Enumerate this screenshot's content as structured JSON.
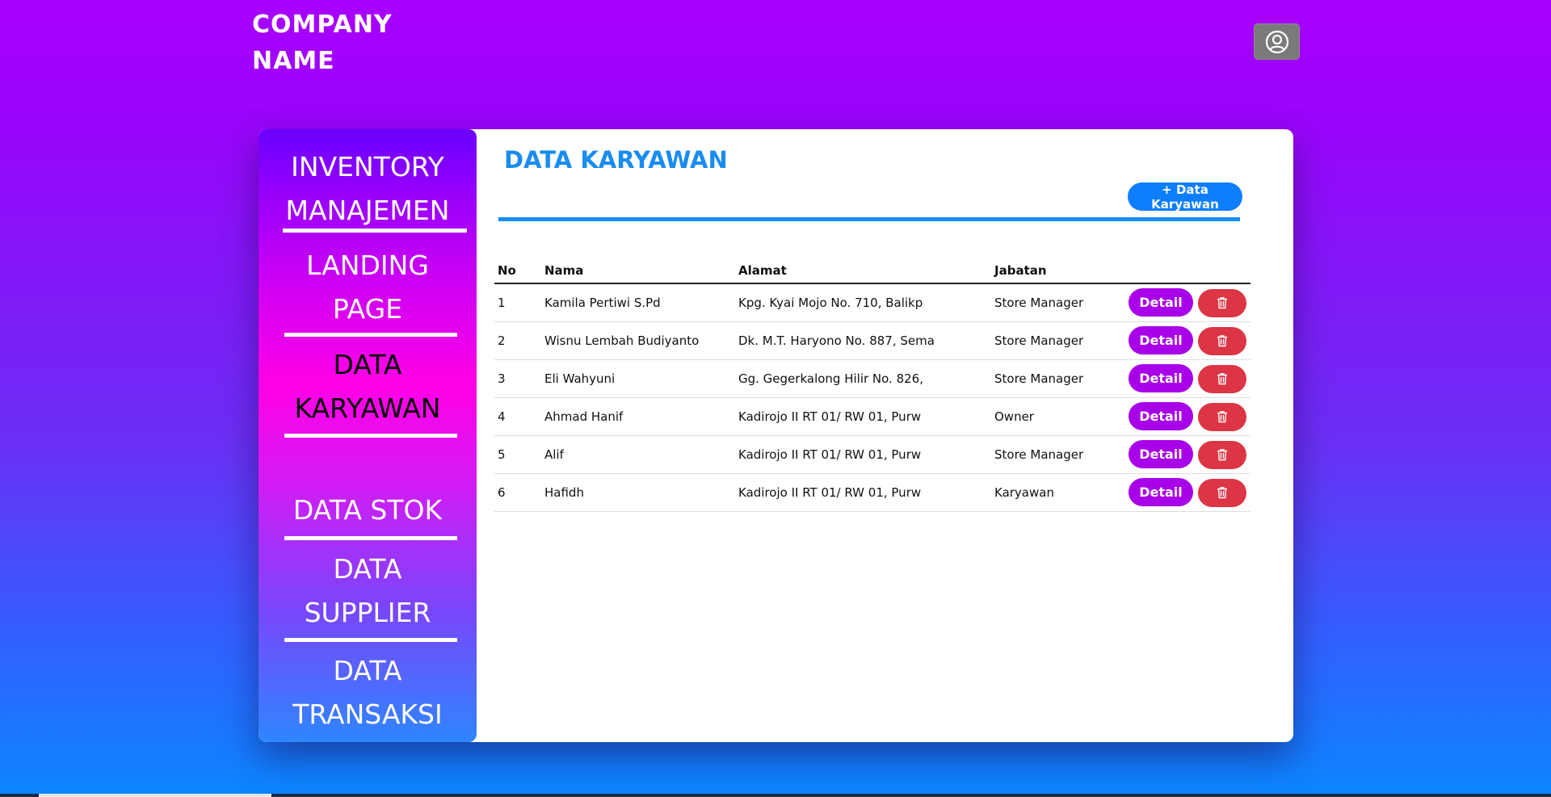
{
  "header": {
    "brand_line1": "COMPANY",
    "brand_line2": "NAME",
    "user_icon": "user-circle-icon"
  },
  "sidebar": {
    "items": [
      {
        "line1": "INVENTORY",
        "line2": "MANAJEMEN"
      },
      {
        "line1": "LANDING",
        "line2": "PAGE"
      },
      {
        "line1": "DATA",
        "line2": "KARYAWAN",
        "active": true
      },
      {
        "line1": "DATA STOK",
        "line2": ""
      },
      {
        "line1": "DATA",
        "line2": "SUPPLIER"
      },
      {
        "line1": "DATA",
        "line2": "TRANSAKSI"
      }
    ]
  },
  "main": {
    "title": "DATA KARYAWAN",
    "add_button": "+ Data Karyawan",
    "table": {
      "headers": [
        "No",
        "Nama",
        "Alamat",
        "Jabatan"
      ],
      "rows": [
        {
          "no": "1",
          "nama": "Kamila Pertiwi S.Pd",
          "alamat": "Kpg. Kyai Mojo No. 710, Balikp",
          "jabatan": "Store Manager"
        },
        {
          "no": "2",
          "nama": "Wisnu Lembah Budiyanto",
          "alamat": "Dk. M.T. Haryono No. 887, Sema",
          "jabatan": "Store Manager"
        },
        {
          "no": "3",
          "nama": "Eli Wahyuni",
          "alamat": "Gg. Gegerkalong Hilir No. 826,",
          "jabatan": "Store Manager"
        },
        {
          "no": "4",
          "nama": "Ahmad Hanif",
          "alamat": "Kadirojo II RT 01/ RW 01, Purw",
          "jabatan": "Owner"
        },
        {
          "no": "5",
          "nama": "Alif",
          "alamat": "Kadirojo II RT 01/ RW 01, Purw",
          "jabatan": "Store Manager"
        },
        {
          "no": "6",
          "nama": "Hafidh",
          "alamat": "Kadirojo II RT 01/ RW 01, Purw",
          "jabatan": "Karyawan"
        }
      ],
      "detail_label": "Detail",
      "delete_icon": "trash-icon"
    }
  },
  "colors": {
    "accent_blue": "#1a8cf0",
    "detail_purple": "#a800e8",
    "delete_red": "#dc3545"
  }
}
